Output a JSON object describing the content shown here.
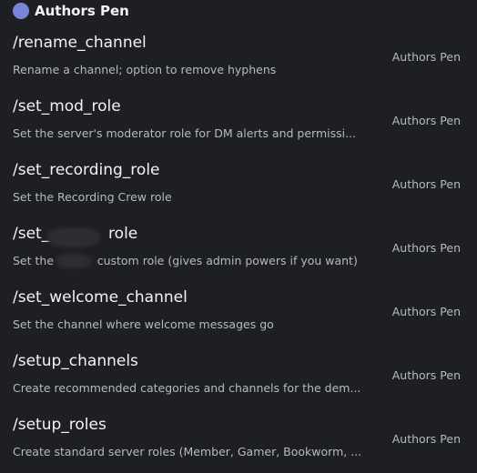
{
  "app": {
    "name": "Authors Pen",
    "avatar_color": "#7984d6"
  },
  "commands": [
    {
      "name": "/rename_channel",
      "description": "Rename a channel; option to remove hyphens",
      "source": "Authors Pen"
    },
    {
      "name": "/set_mod_role",
      "description": "Set the server's moderator role for DM alerts and permissi...",
      "source": "Authors Pen"
    },
    {
      "name": "/set_recording_role",
      "description": "Set the Recording Crew role",
      "source": "Authors Pen"
    },
    {
      "name": "/set_            role",
      "description": "Set the            custom role (gives admin powers if you want)",
      "source": "Authors Pen"
    },
    {
      "name": "/set_welcome_channel",
      "description": "Set the channel where welcome messages go",
      "source": "Authors Pen"
    },
    {
      "name": "/setup_channels",
      "description": "Create recommended categories and channels for the dem...",
      "source": "Authors Pen"
    },
    {
      "name": "/setup_roles",
      "description": "Create standard server roles (Member, Gamer, Bookworm, ...",
      "source": "Authors Pen"
    }
  ]
}
